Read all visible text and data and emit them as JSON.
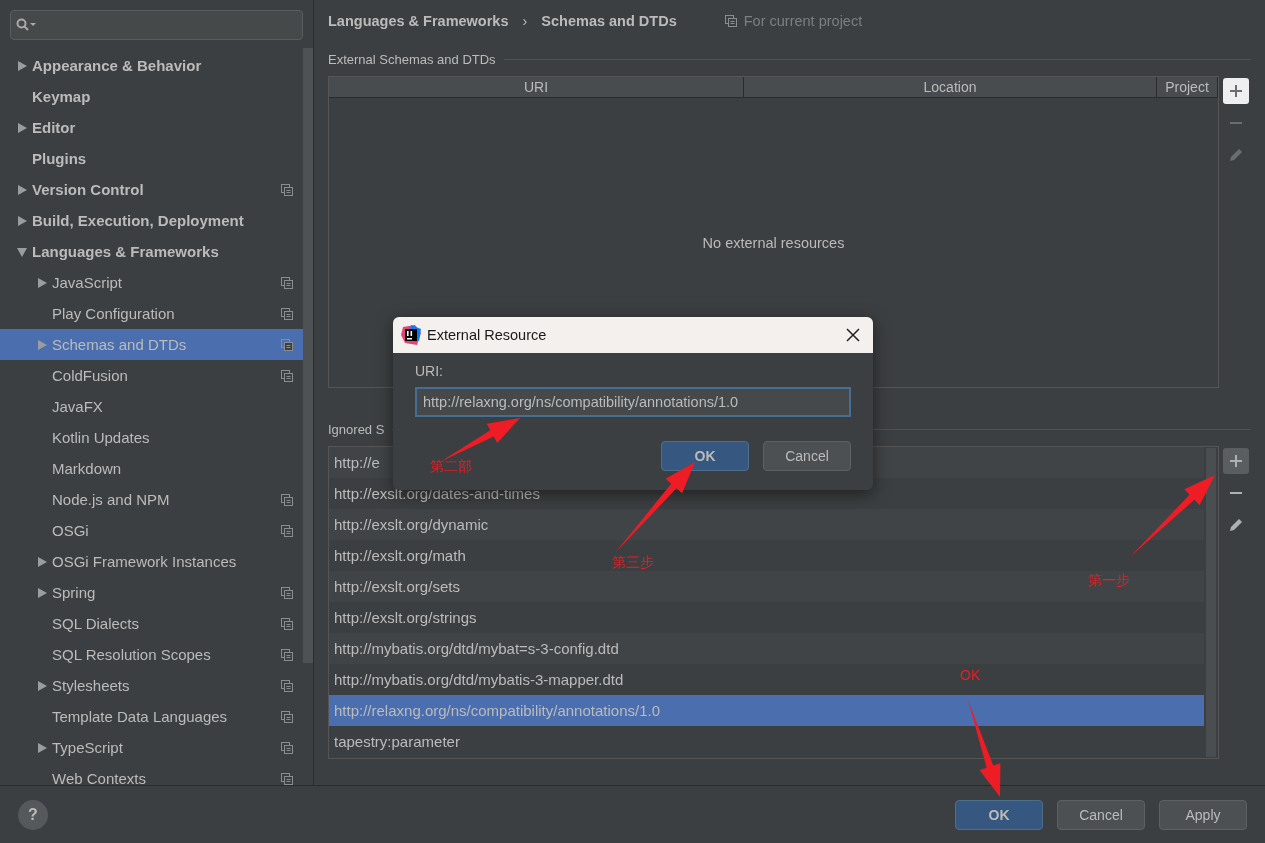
{
  "sidebar": {
    "items": [
      {
        "label": "Appearance & Behavior",
        "expandable": true,
        "expanded": false,
        "project_scope": false,
        "selected": false
      },
      {
        "label": "Keymap",
        "expandable": false,
        "project_scope": false,
        "selected": false
      },
      {
        "label": "Editor",
        "expandable": true,
        "expanded": false,
        "project_scope": false,
        "selected": false
      },
      {
        "label": "Plugins",
        "expandable": false,
        "project_scope": false,
        "selected": false
      },
      {
        "label": "Version Control",
        "expandable": true,
        "expanded": false,
        "project_scope": true,
        "selected": false
      },
      {
        "label": "Build, Execution, Deployment",
        "expandable": true,
        "expanded": false,
        "project_scope": false,
        "selected": false
      },
      {
        "label": "Languages & Frameworks",
        "expandable": true,
        "expanded": true,
        "project_scope": false,
        "selected": false,
        "children": [
          {
            "label": "JavaScript",
            "expandable": true,
            "expanded": false,
            "project_scope": true,
            "selected": false
          },
          {
            "label": "Play Configuration",
            "expandable": false,
            "project_scope": true,
            "selected": false
          },
          {
            "label": "Schemas and DTDs",
            "expandable": true,
            "expanded": false,
            "project_scope": true,
            "selected": true
          },
          {
            "label": "ColdFusion",
            "expandable": false,
            "project_scope": true,
            "selected": false
          },
          {
            "label": "JavaFX",
            "expandable": false,
            "project_scope": false,
            "selected": false
          },
          {
            "label": "Kotlin Updates",
            "expandable": false,
            "project_scope": false,
            "selected": false
          },
          {
            "label": "Markdown",
            "expandable": false,
            "project_scope": false,
            "selected": false
          },
          {
            "label": "Node.js and NPM",
            "expandable": false,
            "project_scope": true,
            "selected": false
          },
          {
            "label": "OSGi",
            "expandable": false,
            "project_scope": true,
            "selected": false
          },
          {
            "label": "OSGi Framework Instances",
            "expandable": true,
            "expanded": false,
            "project_scope": false,
            "selected": false
          },
          {
            "label": "Spring",
            "expandable": true,
            "expanded": false,
            "project_scope": true,
            "selected": false
          },
          {
            "label": "SQL Dialects",
            "expandable": false,
            "project_scope": true,
            "selected": false
          },
          {
            "label": "SQL Resolution Scopes",
            "expandable": false,
            "project_scope": true,
            "selected": false
          },
          {
            "label": "Stylesheets",
            "expandable": true,
            "expanded": false,
            "project_scope": true,
            "selected": false
          },
          {
            "label": "Template Data Languages",
            "expandable": false,
            "project_scope": true,
            "selected": false
          },
          {
            "label": "TypeScript",
            "expandable": true,
            "expanded": false,
            "project_scope": true,
            "selected": false
          },
          {
            "label": "Web Contexts",
            "expandable": false,
            "project_scope": true,
            "selected": false
          }
        ]
      }
    ]
  },
  "breadcrumb": [
    "Languages & Frameworks",
    "Schemas and DTDs"
  ],
  "breadcrumb_separator": "›",
  "scope_note": "For current project",
  "external": {
    "title": "External Schemas and DTDs",
    "columns": [
      "URI",
      "Location",
      "Project"
    ],
    "empty_text": "No external resources"
  },
  "ignored": {
    "title": "Ignored S",
    "rows": [
      {
        "text": "http://e",
        "selected": false
      },
      {
        "text": "http://exslt.org/dates-and-times",
        "selected": false
      },
      {
        "text": "http://exslt.org/dynamic",
        "selected": false
      },
      {
        "text": "http://exslt.org/math",
        "selected": false
      },
      {
        "text": "http://exslt.org/sets",
        "selected": false
      },
      {
        "text": "http://exslt.org/strings",
        "selected": false
      },
      {
        "text": "http://mybatis.org/dtd/mybat=s-3-config.dtd",
        "selected": false
      },
      {
        "text": "http://mybatis.org/dtd/mybatis-3-mapper.dtd",
        "selected": false
      },
      {
        "text": "http://relaxng.org/ns/compatibility/annotations/1.0",
        "selected": true
      },
      {
        "text": "tapestry:parameter",
        "selected": false
      }
    ]
  },
  "dialog": {
    "title": "External Resource",
    "field_label": "URI:",
    "value": "http://relaxng.org/ns/compatibility/annotations/1.0",
    "buttons": [
      {
        "label": "OK",
        "default": true
      },
      {
        "label": "Cancel",
        "default": false
      }
    ]
  },
  "footer": {
    "help": "?",
    "buttons": [
      {
        "label": "OK",
        "default": true
      },
      {
        "label": "Cancel",
        "default": false
      },
      {
        "label": "Apply",
        "default": false
      }
    ]
  },
  "annotations": [
    {
      "text": "第二部"
    },
    {
      "text": "第三步"
    },
    {
      "text": "第一步"
    },
    {
      "text": "OK"
    }
  ]
}
